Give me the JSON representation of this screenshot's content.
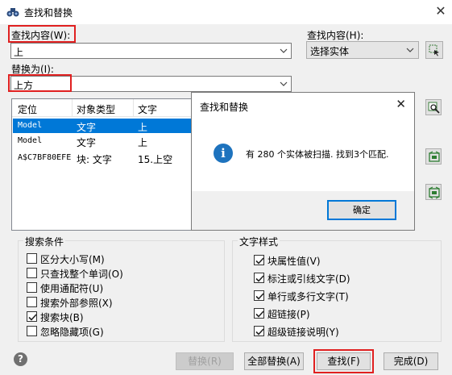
{
  "window": {
    "title": "查找和替换",
    "close_glyph": "✕"
  },
  "find": {
    "label": "查找内容(W):",
    "value": "上"
  },
  "scope": {
    "label": "查找内容(H):",
    "value": "选择实体"
  },
  "replace": {
    "label": "替换为(I):",
    "value": "上方"
  },
  "results": {
    "columns": [
      "定位",
      "对象类型",
      "文字"
    ],
    "rows": [
      {
        "location": "Model",
        "type": "文字",
        "text": "上",
        "selected": true
      },
      {
        "location": "Model",
        "type": "文字",
        "text": "上",
        "selected": false
      },
      {
        "location": "A$C7BF80EFE",
        "type": "块: 文字",
        "text": "15.上空",
        "selected": false
      }
    ]
  },
  "popup": {
    "title": "查找和替换",
    "close_glyph": "✕",
    "info_glyph": "i",
    "message": "有 280 个实体被扫描. 找到3个匹配.",
    "ok_label": "确定"
  },
  "search_conditions": {
    "title": "搜索条件",
    "items": [
      {
        "label": "区分大小写(M)",
        "checked": false
      },
      {
        "label": "只查找整个单词(O)",
        "checked": false
      },
      {
        "label": "使用通配符(U)",
        "checked": false
      },
      {
        "label": "搜索外部参照(X)",
        "checked": false
      },
      {
        "label": "搜索块(B)",
        "checked": true
      },
      {
        "label": "忽略隐藏项(G)",
        "checked": false
      }
    ]
  },
  "text_styles": {
    "title": "文字样式",
    "items": [
      {
        "label": "块属性值(V)",
        "checked": true
      },
      {
        "label": "标注或引线文字(D)",
        "checked": true
      },
      {
        "label": "单行或多行文字(T)",
        "checked": true
      },
      {
        "label": "超链接(P)",
        "checked": true
      },
      {
        "label": "超级链接说明(Y)",
        "checked": true
      }
    ]
  },
  "buttons": {
    "help_glyph": "?",
    "replace": "替换(R)",
    "replace_all": "全部替换(A)",
    "find": "查找(F)",
    "done": "完成(D)"
  },
  "colors": {
    "accent": "#0078d7",
    "highlight_box": "#e02020",
    "info_icon": "#1e73be"
  }
}
